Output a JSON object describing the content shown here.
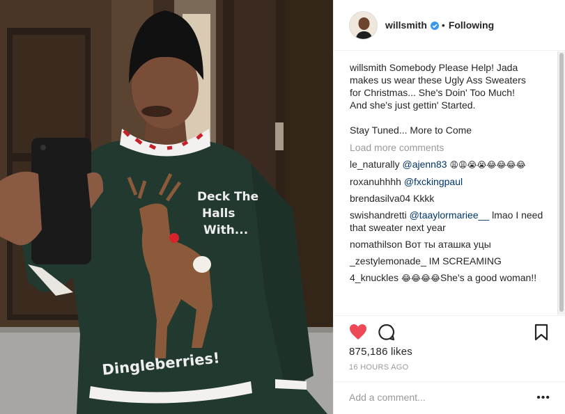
{
  "post": {
    "image_alt_text": "",
    "sweater_text_line1": "Deck The",
    "sweater_text_line2": "Halls",
    "sweater_text_line3": "With...",
    "sweater_text_bottom": "Dingleberries!"
  },
  "header": {
    "username": "willsmith",
    "separator": "•",
    "follow_status": "Following",
    "icons": {
      "verified": "verified-badge-icon"
    }
  },
  "caption": {
    "username": "willsmith",
    "lines": [
      "Somebody Please Help! Jada",
      "makes us wear these Ugly Ass Sweaters",
      "for Christmas... She's Doin' Too Much!",
      "And she's just gettin' Started."
    ],
    "closing": "Stay Tuned... More to Come"
  },
  "load_more_label": "Load more comments",
  "comments": [
    {
      "user": "le_naturally",
      "mention": "@ajenn83",
      "text": "",
      "emoji": "😩😩😭😭😂😂😂😂"
    },
    {
      "user": "roxanuhhhh",
      "mention": "@fxckingpaul",
      "text": "",
      "emoji": ""
    },
    {
      "user": "brendasilva04",
      "mention": "",
      "text": "Kkkk",
      "emoji": ""
    },
    {
      "user": "swishandretti",
      "mention": "@taaylormariee__",
      "text": "lmao I need that sweater next year",
      "emoji": ""
    },
    {
      "user": "nomathilson",
      "mention": "",
      "text": "Вот ты аташка уцы",
      "emoji": ""
    },
    {
      "user": "_zestylemonade_",
      "mention": "",
      "text": "IM SCREAMING",
      "emoji": ""
    },
    {
      "user": "4_knuckles",
      "mention": "",
      "text": "She's a good woman!!",
      "emoji": "😂😂😂😂"
    }
  ],
  "actions": {
    "icons": {
      "like": "heart-icon",
      "comment": "comment-bubble-icon",
      "save": "bookmark-icon",
      "more": "more-options-icon"
    },
    "like_color": "#ed4956",
    "likes_text": "875,186 likes",
    "timestamp": "16 HOURS AGO",
    "add_comment_placeholder": "Add a comment...",
    "more_label": "•••"
  },
  "colors": {
    "mention": "#003569",
    "muted": "#999999",
    "verified": "#3897f0"
  }
}
